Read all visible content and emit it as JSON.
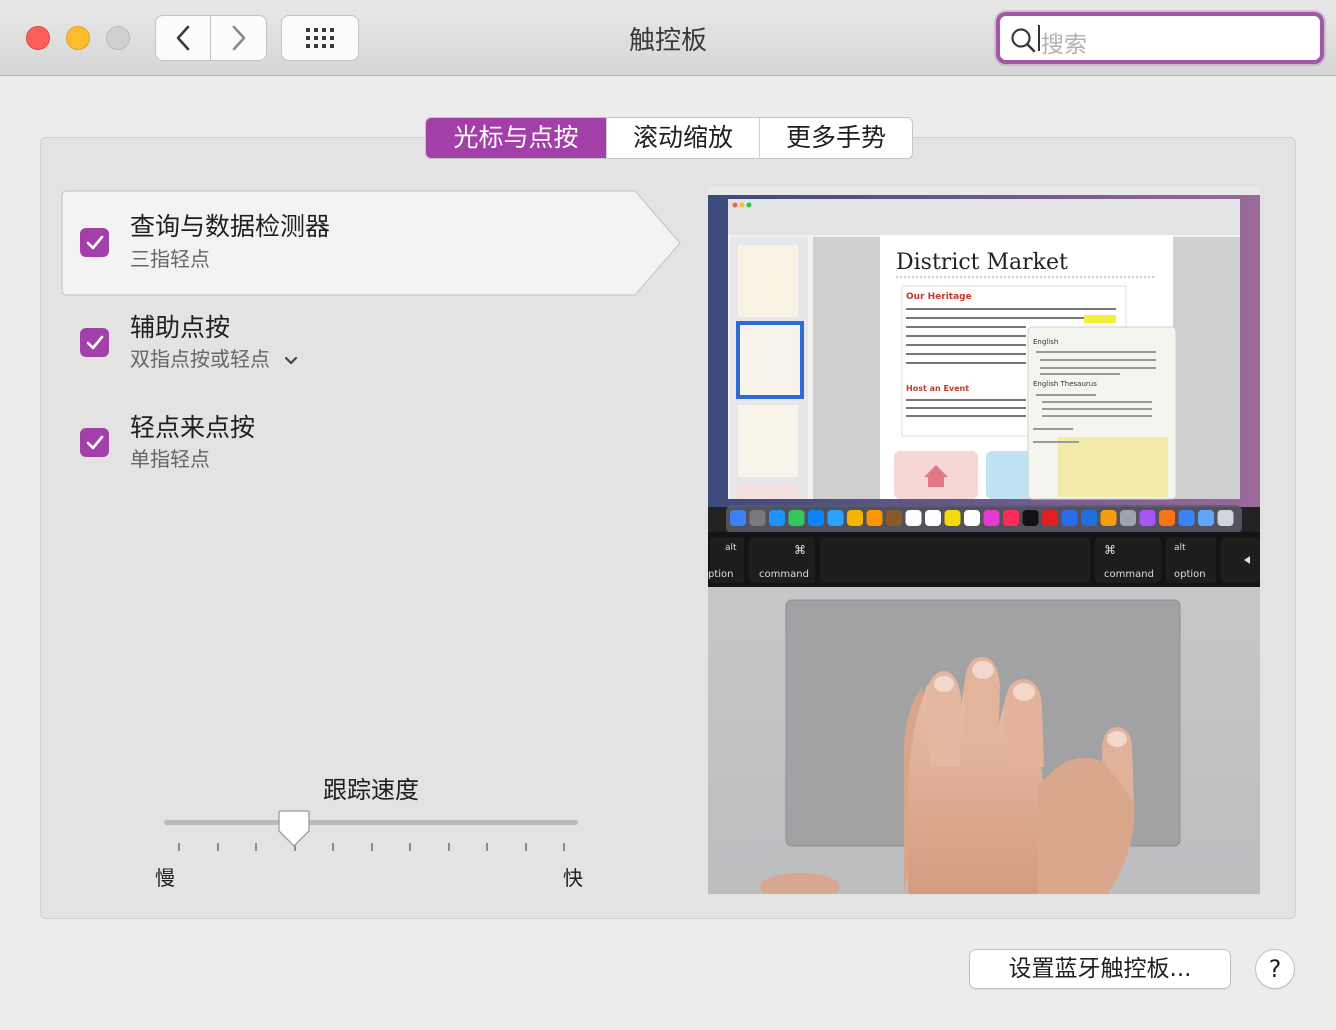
{
  "window": {
    "title": "触控板"
  },
  "search": {
    "placeholder": "搜索"
  },
  "tabs": [
    {
      "label": "光标与点按",
      "active": true
    },
    {
      "label": "滚动缩放",
      "active": false
    },
    {
      "label": "更多手势",
      "active": false
    }
  ],
  "options": [
    {
      "title": "查询与数据检测器",
      "subtitle": "三指轻点",
      "checked": true,
      "selected": true
    },
    {
      "title": "辅助点按",
      "subtitle": "双指点按或轻点",
      "checked": true,
      "has_dropdown": true
    },
    {
      "title": "轻点来点按",
      "subtitle": "单指轻点",
      "checked": true
    }
  ],
  "tracking": {
    "label": "跟踪速度",
    "min_label": "慢",
    "max_label": "快",
    "value_step": 3,
    "steps": 10
  },
  "preview": {
    "doc_title": "District Market",
    "section1": "Our Heritage",
    "section2": "Host an Event",
    "popup_heading": "English",
    "popup_thesaurus": "English Thesaurus",
    "key_alt": "alt",
    "key_option": "option",
    "key_command": "command",
    "key_option_partial": "ption"
  },
  "footer": {
    "bluetooth_button": "设置蓝牙触控板...",
    "help_button": "?"
  },
  "colors": {
    "accent": "#a33fa8",
    "focus_ring": "#a356a6"
  }
}
